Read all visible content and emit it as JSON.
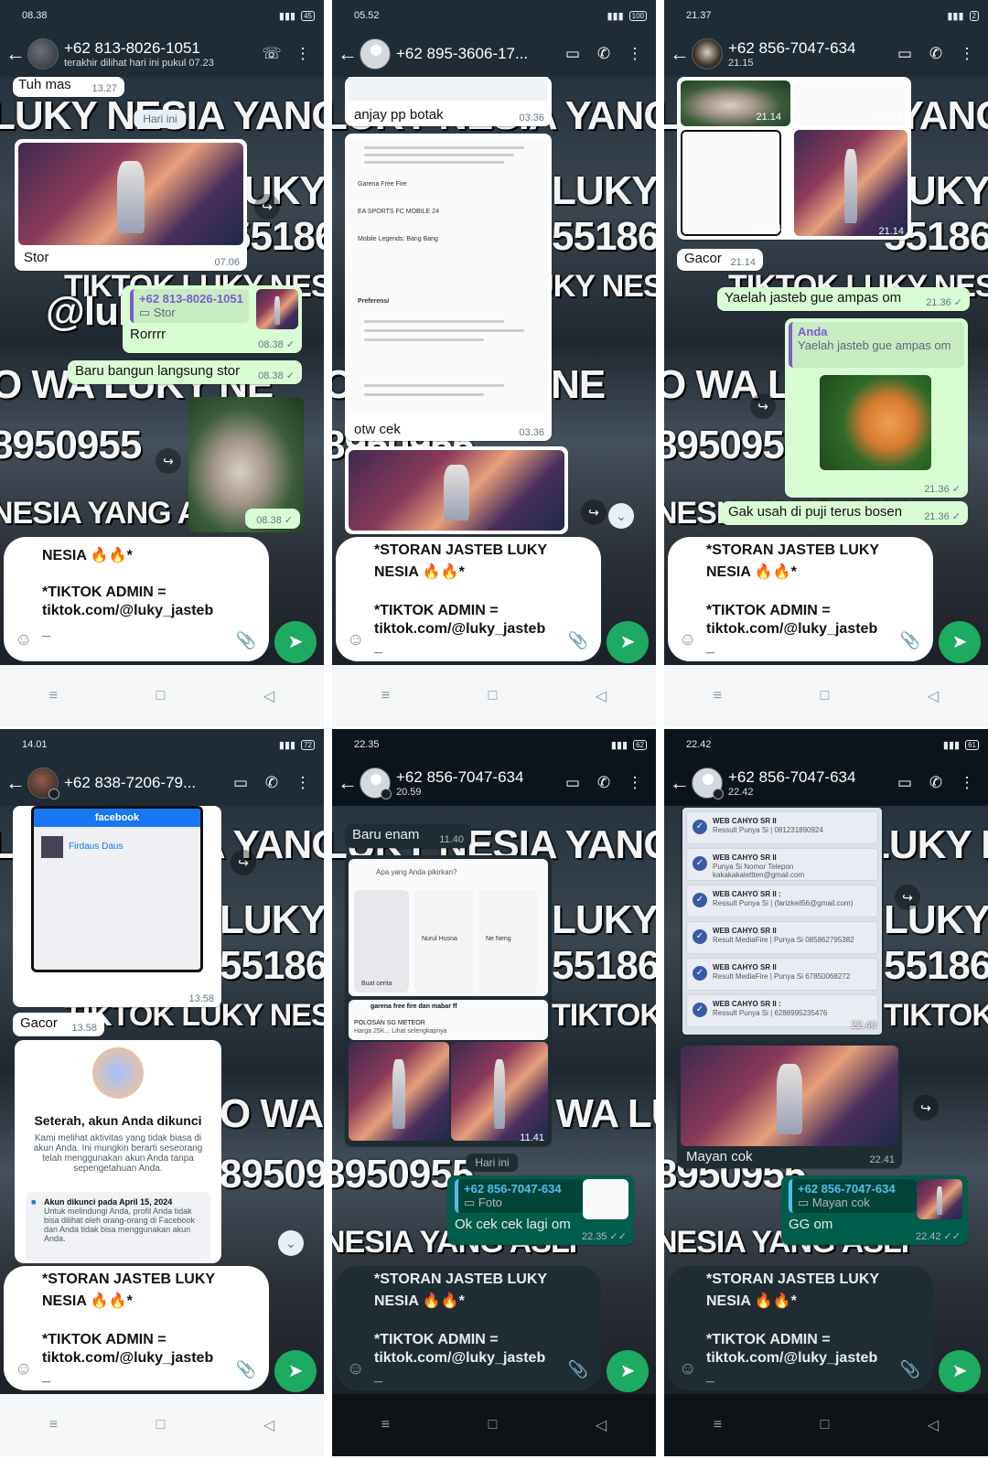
{
  "common": {
    "input_line1": "*STORAN JASTEB LUKY",
    "input_line2": "NESIA 🔥🔥*",
    "input_line3": "*TIKTOK ADMIN =",
    "input_line4": "tiktok.com/@luky_jasteb",
    "input_line5": "_",
    "emoji_icon": "☺",
    "attach_icon": "📎",
    "send_icon": "➤",
    "watermark_rows": [
      "LUKY NESIA YANG ASLI",
      "LUKY",
      "55186",
      "TIKTOK LUKY NESIA YAN",
      "@luky",
      "O WA LUKY NE",
      "8950955",
      "NESIA YANG ASLI"
    ],
    "nav": [
      "≡",
      "□",
      "◁"
    ],
    "colors": {
      "send": "#1daa61",
      "out_bubble": "#d9fdd3",
      "dark_out_bubble": "#005c4b",
      "header": "#1f2b35"
    }
  },
  "p1": {
    "time": "08.38",
    "battery": "45",
    "name": "+62 813-8026-1051",
    "sub": "terakhir dilihat hari ini pukul 07.23",
    "msg1": "Tuh mas",
    "msg1_time": "13.27",
    "date": "Hari ini",
    "img_caption": "Stor",
    "img_time": "07.06",
    "quote_name": "+62 813-8026-1051",
    "quote_text": "▭ Stor",
    "reply": "Rorrrr",
    "reply_time": "08.38 ✓",
    "msg2": "Baru bangun langsung stor",
    "msg2_time": "08.38 ✓",
    "cat_time": "08.38 ✓",
    "input_first": "NESIA 🔥🔥*"
  },
  "p2": {
    "time": "05.52",
    "battery": "100",
    "name": "+62 895-3606-17...",
    "msg1": "anjay pp botak",
    "msg1_time": "03.36",
    "doc_items": [
      "Garena Free Fire",
      "EA SPORTS FC MOBILE 24",
      "Mobile Legends: Bang Bang"
    ],
    "doc_heading": "Preferensi",
    "msg2": "otw cek",
    "msg2_time": "03.36"
  },
  "p3": {
    "time": "21.37",
    "battery": "2",
    "name": "+62 856-7047-634",
    "sub": "21.15",
    "img_times": [
      "21.14",
      "21.14",
      "21.14",
      "21.14"
    ],
    "msg1": "Gacor",
    "msg1_time": "21.14",
    "msg2": "Yaelah jasteb gue ampas om",
    "msg2_time": "21.36 ✓",
    "quote_name": "Anda",
    "quote_text": "Yaelah jasteb gue ampas om",
    "sticker_time": "21.36 ✓",
    "msg3": "Gak usah di puji terus bosen",
    "msg3_time": "21.36 ✓"
  },
  "p4": {
    "time": "14.01",
    "battery": "72",
    "name": "+62 838-7206-79...",
    "fb_label": "facebook",
    "fb_user": "Firdaus Daus",
    "fb_time": "13.58",
    "msg1": "Gacor",
    "msg1_time": "13.58",
    "lock_title": "Seterah, akun Anda dikunci",
    "lock_body": "Kami melihat aktivitas yang tidak biasa di akun Anda. Ini mungkin berarti seseorang telah menggunakan akun Anda tanpa sepengetahuan Anda.",
    "lock_date": "Akun dikunci pada April 15, 2024",
    "lock_detail": "Untuk melindungi Anda, profil Anda tidak bisa dilihat oleh orang-orang di Facebook dan Anda tidak bisa menggunakan akun Anda."
  },
  "p5": {
    "time": "22.35",
    "battery": "62",
    "name": "+62 856-7047-634",
    "sub": "20.59",
    "msg1": "Baru enam",
    "msg1_time": "11.40",
    "fb_prompt": "Apa yang Anda pikirkan?",
    "stories": [
      "Buat cerita",
      "Nurul Husna",
      "Ne Neng"
    ],
    "post_author": "garena free fire dan mabar ff",
    "post_text": "POLOSAN SG METEOR",
    "post_price": "Harga 25K... Lihat selengkapnya",
    "img_time": "11.41",
    "date": "Hari ini",
    "quote_name": "+62 856-7047-634",
    "quote_text": "▭ Foto",
    "reply": "Ok cek cek lagi om",
    "reply_time": "22.35 ✓✓"
  },
  "p6": {
    "time": "22.42",
    "battery": "61",
    "name": "+62 856-7047-634",
    "sub": "22.42",
    "cards": [
      {
        "title": "WEB CAHYO SR II",
        "sub": "Ressult Punya Si | 081231890924"
      },
      {
        "title": "WEB CAHYO SR II",
        "sub": "Punya Si Nomor Telepon kakakakalettten@gmail.com"
      },
      {
        "title": "WEB CAHYO SR II :",
        "sub": "Ressult Punya Si | (farizkeil56@gmail.com)"
      },
      {
        "title": "WEB CAHYO SR II",
        "sub": "Result MediaFire | Punya Si 085862795382"
      },
      {
        "title": "WEB CAHYO SR II",
        "sub": "Result MediaFire | Punya Si 67850068272"
      },
      {
        "title": "WEB CAHYO SR II :",
        "sub": "Ressult Punya Si | 6288995235476"
      }
    ],
    "cards_time": "22.40",
    "img_caption": "Mayan cok",
    "img_time": "22.41",
    "quote_name": "+62 856-7047-634",
    "quote_text": "▭ Mayan cok",
    "reply": "GG om",
    "reply_time": "22.42 ✓✓"
  }
}
